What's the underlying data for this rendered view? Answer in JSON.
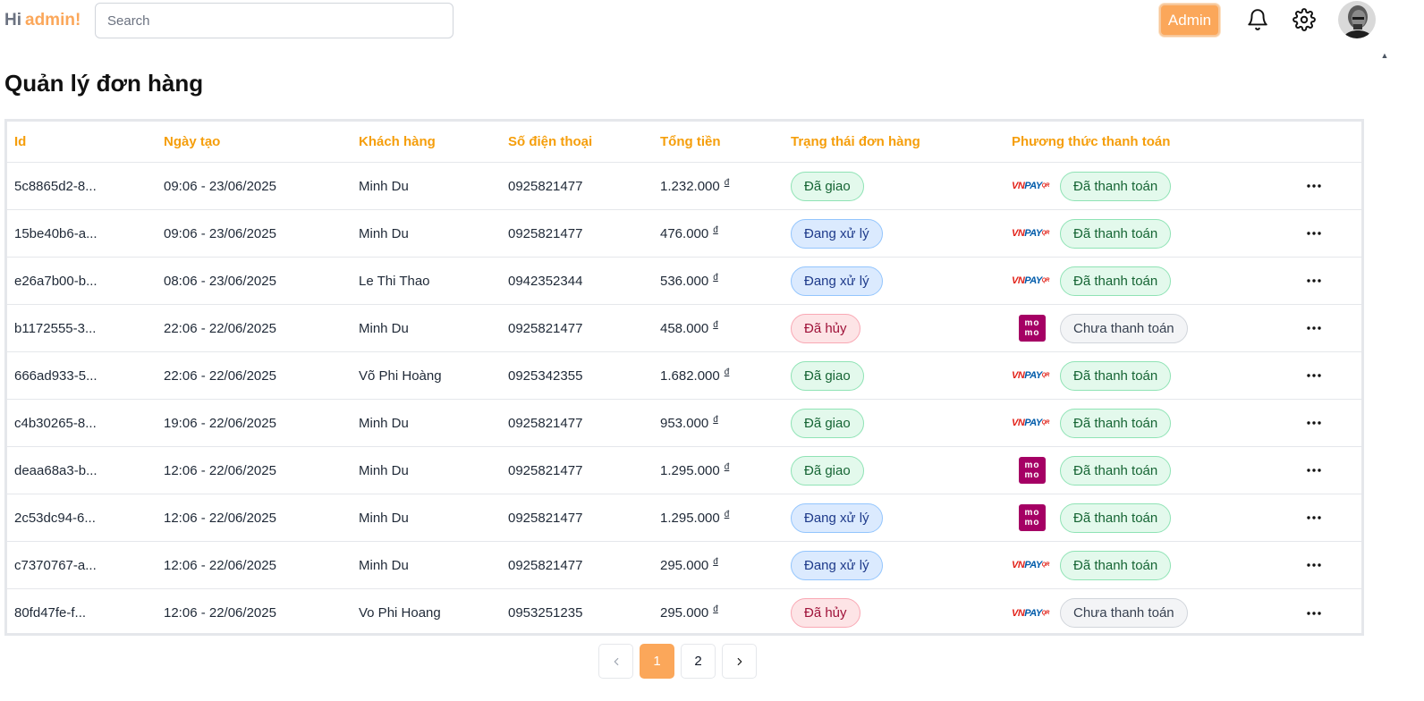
{
  "header": {
    "greeting": "Hi",
    "username": "admin!",
    "search_placeholder": "Search",
    "role_label": "Admin"
  },
  "page_title": "Quản lý đơn hàng",
  "table": {
    "columns": [
      "Id",
      "Ngày tạo",
      "Khách hàng",
      "Số điện thoại",
      "Tổng tiền",
      "Trạng thái đơn hàng",
      "Phương thức thanh toán"
    ],
    "currency_symbol": "đ",
    "rows": [
      {
        "id": "5c8865d2-8...",
        "date": "09:06 - 23/06/2025",
        "customer": "Minh Du",
        "phone": "0925821477",
        "total": "1.232.000",
        "status": "Đã giao",
        "status_type": "green",
        "method": "vnpay",
        "payment": "Đã thanh toán",
        "payment_type": "green"
      },
      {
        "id": "15be40b6-a...",
        "date": "09:06 - 23/06/2025",
        "customer": "Minh Du",
        "phone": "0925821477",
        "total": "476.000",
        "status": "Đang xử lý",
        "status_type": "blue",
        "method": "vnpay",
        "payment": "Đã thanh toán",
        "payment_type": "green"
      },
      {
        "id": "e26a7b00-b...",
        "date": "08:06 - 23/06/2025",
        "customer": "Le Thi Thao",
        "phone": "0942352344",
        "total": "536.000",
        "status": "Đang xử lý",
        "status_type": "blue",
        "method": "vnpay",
        "payment": "Đã thanh toán",
        "payment_type": "green"
      },
      {
        "id": "b1172555-3...",
        "date": "22:06 - 22/06/2025",
        "customer": "Minh Du",
        "phone": "0925821477",
        "total": "458.000",
        "status": "Đã hủy",
        "status_type": "red",
        "method": "momo",
        "payment": "Chưa thanh toán",
        "payment_type": "gray"
      },
      {
        "id": "666ad933-5...",
        "date": "22:06 - 22/06/2025",
        "customer": "Võ Phi Hoàng",
        "phone": "0925342355",
        "total": "1.682.000",
        "status": "Đã giao",
        "status_type": "green",
        "method": "vnpay",
        "payment": "Đã thanh toán",
        "payment_type": "green"
      },
      {
        "id": "c4b30265-8...",
        "date": "19:06 - 22/06/2025",
        "customer": "Minh Du",
        "phone": "0925821477",
        "total": "953.000",
        "status": "Đã giao",
        "status_type": "green",
        "method": "vnpay",
        "payment": "Đã thanh toán",
        "payment_type": "green"
      },
      {
        "id": "deaa68a3-b...",
        "date": "12:06 - 22/06/2025",
        "customer": "Minh Du",
        "phone": "0925821477",
        "total": "1.295.000",
        "status": "Đã giao",
        "status_type": "green",
        "method": "momo",
        "payment": "Đã thanh toán",
        "payment_type": "green"
      },
      {
        "id": "2c53dc94-6...",
        "date": "12:06 - 22/06/2025",
        "customer": "Minh Du",
        "phone": "0925821477",
        "total": "1.295.000",
        "status": "Đang xử lý",
        "status_type": "blue",
        "method": "momo",
        "payment": "Đã thanh toán",
        "payment_type": "green"
      },
      {
        "id": "c7370767-a...",
        "date": "12:06 - 22/06/2025",
        "customer": "Minh Du",
        "phone": "0925821477",
        "total": "295.000",
        "status": "Đang xử lý",
        "status_type": "blue",
        "method": "vnpay",
        "payment": "Đã thanh toán",
        "payment_type": "green"
      },
      {
        "id": "80fd47fe-f...",
        "date": "12:06 - 22/06/2025",
        "customer": "Vo Phi Hoang",
        "phone": "0953251235",
        "total": "295.000",
        "status": "Đã hủy",
        "status_type": "red",
        "method": "vnpay",
        "payment": "Chưa thanh toán",
        "payment_type": "gray"
      }
    ]
  },
  "logos": {
    "vnpay_vn": "VN",
    "vnpay_pay": "PAY",
    "vnpay_qr": "QR",
    "momo_top": "mo",
    "momo_bottom": "mo"
  },
  "pagination": {
    "pages": [
      "1",
      "2"
    ],
    "current": "1"
  },
  "colors": {
    "accent": "#fba75a",
    "header_text": "#f59e0b"
  }
}
